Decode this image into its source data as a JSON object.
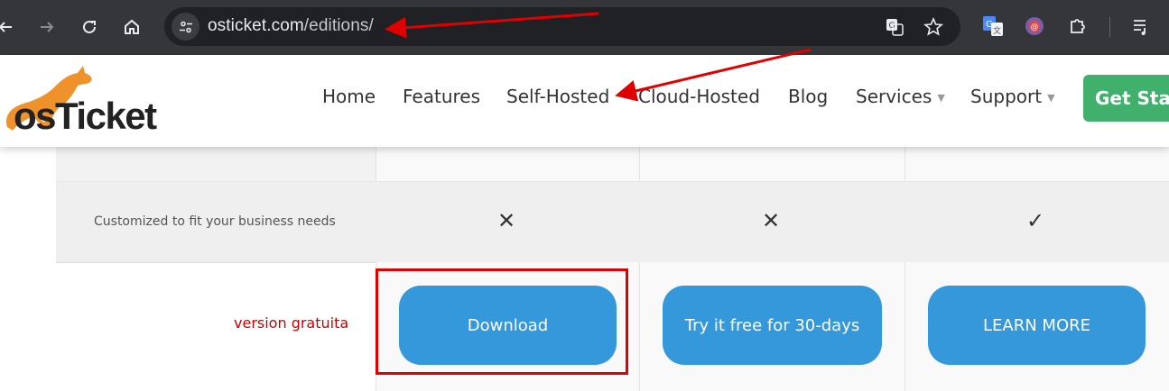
{
  "browser": {
    "url_host": "osticket.com",
    "url_path": "/editions/",
    "icons": [
      "back-icon",
      "forward-icon",
      "reload-icon",
      "home-icon",
      "site-info-icon",
      "translate-icon",
      "bookmark-star-icon",
      "google-translate-extension-icon",
      "extension-icon",
      "puzzle-extensions-icon",
      "media-queue-icon"
    ]
  },
  "header": {
    "logo_text": "osTicket",
    "nav": {
      "home": "Home",
      "features": "Features",
      "self_hosted": "Self-Hosted",
      "cloud_hosted": "Cloud-Hosted",
      "blog": "Blog",
      "services": "Services",
      "support": "Support"
    },
    "get_started": "Get Star",
    "brand_color": "#41b06c"
  },
  "table": {
    "row_label": "Customized to fit your business needs",
    "marks": [
      "✕",
      "✕",
      "✓"
    ],
    "buttons": {
      "download": "Download",
      "trial": "Try it free for 30-days",
      "learn_more": "LEARN MORE"
    },
    "button_color": "#3498db"
  },
  "annotation": {
    "label": "version gratuita",
    "color": "#e00000"
  }
}
